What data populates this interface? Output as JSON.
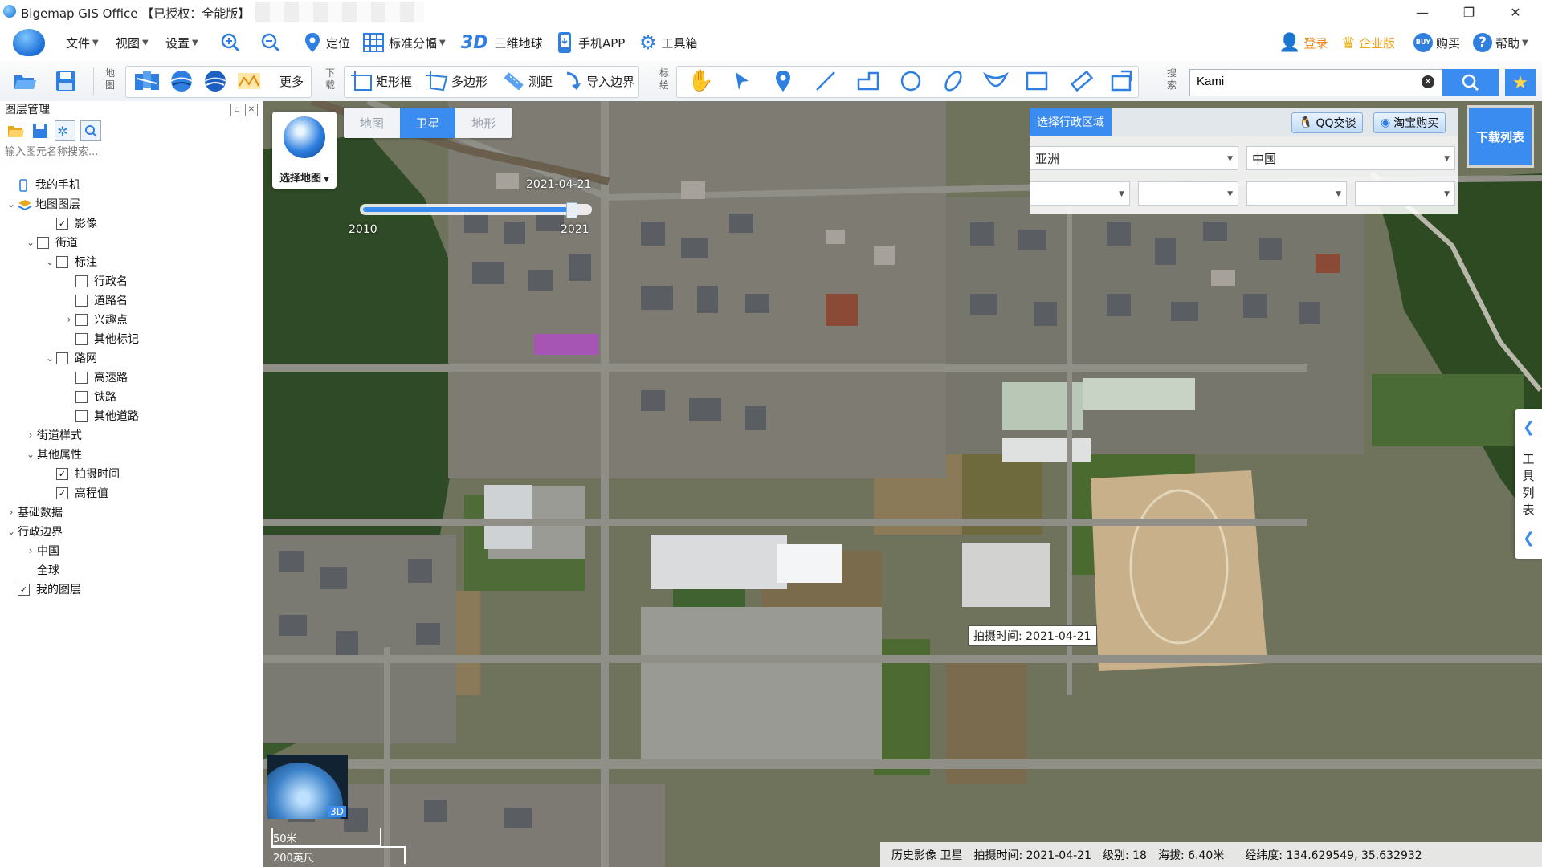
{
  "window": {
    "title": "Bigemap GIS Office 【已授权：全能版】",
    "controls": [
      "—",
      "❐",
      "✕"
    ]
  },
  "menu": {
    "file": "文件",
    "view": "视图",
    "settings": "设置",
    "locate": "定位",
    "grid": "标准分幅",
    "three_d_label": "3D",
    "globe": "三维地球",
    "mobile_app": "手机APP",
    "toolbox": "工具箱",
    "login": "登录",
    "enterprise": "企业版",
    "buy_badge": "BUY",
    "buy": "购买",
    "help": "帮助"
  },
  "toolbar": {
    "map_label": "地图",
    "more": "更多",
    "download_label": "下载",
    "rect": "矩形框",
    "polygon": "多边形",
    "measure": "测距",
    "import_border": "导入边界",
    "mark_label": "标绘",
    "search_label": "搜索",
    "search_value": "Kami"
  },
  "layers": {
    "panel_title": "图层管理",
    "search_placeholder": "输入图元名称搜索...",
    "items": [
      {
        "label": "我的手机",
        "indent": 0,
        "toggle": "",
        "check": "none",
        "icon": "phone"
      },
      {
        "label": "地图图层",
        "indent": 0,
        "toggle": "⌄",
        "check": "none",
        "icon": "layers"
      },
      {
        "label": "影像",
        "indent": 2,
        "toggle": "",
        "check": "checked",
        "icon": ""
      },
      {
        "label": "街道",
        "indent": 1,
        "toggle": "⌄",
        "check": "unchecked",
        "icon": ""
      },
      {
        "label": "标注",
        "indent": 2,
        "toggle": "⌄",
        "check": "unchecked",
        "icon": ""
      },
      {
        "label": "行政名",
        "indent": 3,
        "toggle": "",
        "check": "unchecked",
        "icon": ""
      },
      {
        "label": "道路名",
        "indent": 3,
        "toggle": "",
        "check": "unchecked",
        "icon": ""
      },
      {
        "label": "兴趣点",
        "indent": 3,
        "toggle": "›",
        "check": "unchecked",
        "icon": ""
      },
      {
        "label": "其他标记",
        "indent": 3,
        "toggle": "",
        "check": "unchecked",
        "icon": ""
      },
      {
        "label": "路网",
        "indent": 2,
        "toggle": "⌄",
        "check": "unchecked",
        "icon": ""
      },
      {
        "label": "高速路",
        "indent": 3,
        "toggle": "",
        "check": "unchecked",
        "icon": ""
      },
      {
        "label": "铁路",
        "indent": 3,
        "toggle": "",
        "check": "unchecked",
        "icon": ""
      },
      {
        "label": "其他道路",
        "indent": 3,
        "toggle": "",
        "check": "unchecked",
        "icon": ""
      },
      {
        "label": "街道样式",
        "indent": 1,
        "toggle": "›",
        "check": "none",
        "icon": ""
      },
      {
        "label": "其他属性",
        "indent": 1,
        "toggle": "⌄",
        "check": "none",
        "icon": ""
      },
      {
        "label": "拍摄时间",
        "indent": 2,
        "toggle": "",
        "check": "checked",
        "icon": ""
      },
      {
        "label": "高程值",
        "indent": 2,
        "toggle": "",
        "check": "checked",
        "icon": ""
      },
      {
        "label": "基础数据",
        "indent": 0,
        "toggle": "›",
        "check": "none",
        "icon": ""
      },
      {
        "label": "行政边界",
        "indent": 0,
        "toggle": "⌄",
        "check": "none",
        "icon": ""
      },
      {
        "label": "中国",
        "indent": 1,
        "toggle": "›",
        "check": "none",
        "icon": ""
      },
      {
        "label": "全球",
        "indent": 1,
        "toggle": "",
        "check": "none",
        "icon": ""
      },
      {
        "label": "我的图层",
        "indent": 0,
        "toggle": "",
        "check": "checked",
        "icon": ""
      }
    ]
  },
  "map": {
    "selector_label": "选择地图",
    "types": [
      "地图",
      "卫星",
      "地形"
    ],
    "active_type": "卫星",
    "timeline": {
      "date": "2021-04-21",
      "start": "2010",
      "end": "2021",
      "position": 0.95
    },
    "region": {
      "title": "选择行政区域",
      "qq": "QQ交谈",
      "taobao": "淘宝购买",
      "continent": "亚洲",
      "country": "中国"
    },
    "download_list": "下载列表",
    "tool_list": [
      "工",
      "具",
      "列",
      "表"
    ],
    "tooltip": "拍摄时间: 2021-04-21",
    "minimap_badge": "3D",
    "scale": {
      "metric": "50米",
      "imperial": "200英尺"
    }
  },
  "status": {
    "source": "历史影像 卫星",
    "capture": "拍摄时间: 2021-04-21",
    "level": "级别:  18",
    "altitude": "海拔: 6.40米",
    "coords": "经纬度:  134.629549, 35.632932"
  },
  "colors": {
    "accent": "#3b8cf0",
    "vegetation": "#3d5a2e",
    "road": "#8f8f88"
  }
}
